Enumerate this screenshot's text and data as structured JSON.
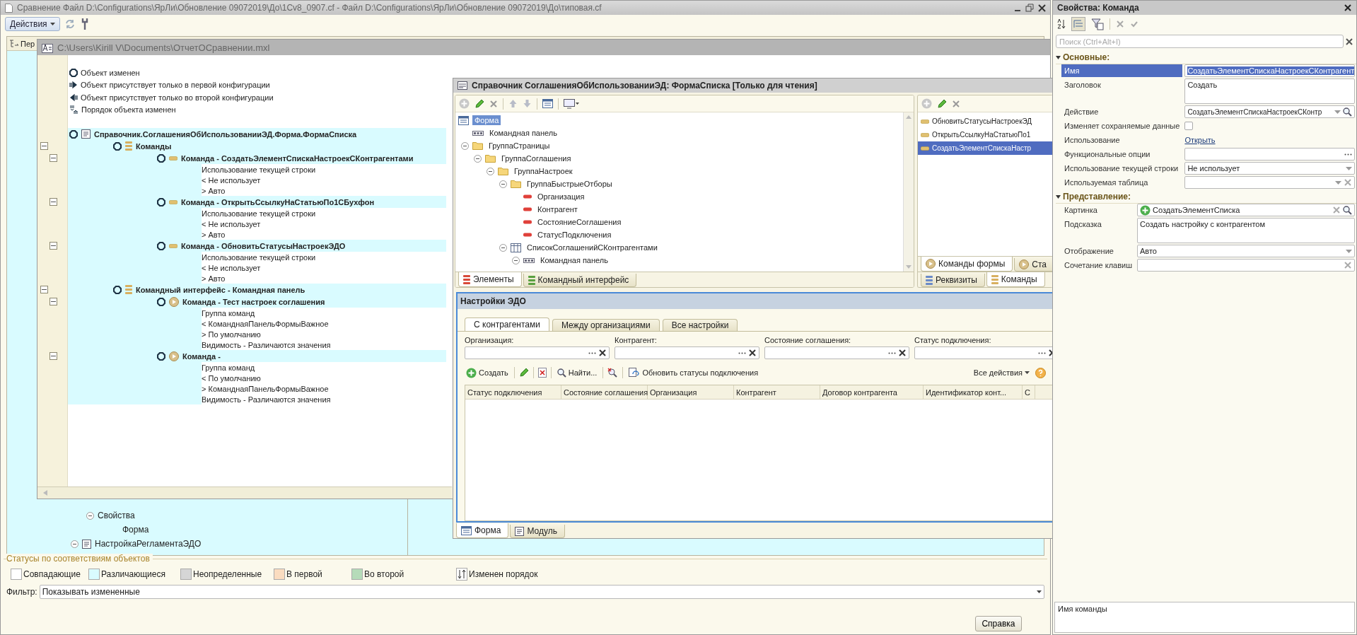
{
  "main_window": {
    "title": "Сравнение Файл D:\\Configurations\\ЯрЛи\\Обновление 09072019\\До\\1Cv8_0907.cf - Файл D:\\Configurations\\ЯрЛи\\Обновление 09072019\\До\\типовая.cf",
    "actions_button": "Действия",
    "column_header": "Пер",
    "tree_items": [
      {
        "label": "Свойства",
        "kind": "group",
        "expanded": true,
        "children": [
          {
            "label": "Форма",
            "kind": "leaf"
          }
        ]
      },
      {
        "label": "НастройкаРегламентаЭДО",
        "kind": "form",
        "expanded": true
      }
    ],
    "legend": {
      "title": "Статусы по соответствиям объектов",
      "items": [
        {
          "label": "Совпадающие",
          "kind": "swatch",
          "color": "#ffffff"
        },
        {
          "label": "Различающиеся",
          "kind": "swatch",
          "color": "#d9fbff"
        },
        {
          "label": "Неопределенные",
          "kind": "swatch",
          "color": "#d6d6d6"
        },
        {
          "label": "В первой",
          "kind": "swatch",
          "color": "#fadcc0"
        },
        {
          "label": "Во второй",
          "kind": "swatch",
          "color": "#b5dbb9"
        },
        {
          "label": "Изменен порядок",
          "kind": "order"
        }
      ]
    },
    "filter": {
      "label": "Фильтр:",
      "value": "Показывать измененные"
    },
    "help_button": "Справка"
  },
  "report_window": {
    "title": "C:\\Users\\Kirill V\\Documents\\ОтчетОСравнении.mxl",
    "legend_lines": [
      {
        "kind": "changed",
        "text": "Объект изменен"
      },
      {
        "kind": "first",
        "text": "Объект присутствует только в первой конфигурации"
      },
      {
        "kind": "second",
        "text": "Объект присутствует только во второй конфигурации"
      },
      {
        "kind": "order",
        "text": "Порядок объекта изменен"
      }
    ],
    "tree": {
      "label": "Справочник.СоглашенияОбИспользованииЭД.Форма.ФормаСписка",
      "kind": "form",
      "children": [
        {
          "label": "Команды",
          "kind": "group",
          "expanded": true,
          "children": [
            {
              "label": "Команда - СоздатьЭлементСпискаНастроекСКонтрагентами",
              "kind": "command",
              "expanded": true,
              "details": [
                "Использование текущей строки",
                "< Не использует",
                "> Авто"
              ]
            },
            {
              "label": "Команда - ОткрытьСсылкуНаСтатьюПо1СБухфон",
              "kind": "command",
              "expanded": true,
              "details": [
                "Использование текущей строки",
                "< Не использует",
                "> Авто"
              ]
            },
            {
              "label": "Команда - ОбновитьСтатусыНастроекЭДО",
              "kind": "command",
              "expanded": true,
              "details": [
                "Использование текущей строки",
                "< Не использует",
                "> Авто"
              ]
            }
          ]
        },
        {
          "label": "Командный интерфейс - Командная панель",
          "kind": "group",
          "expanded": true,
          "children": [
            {
              "label": "Команда - Тест настроек соглашения",
              "kind": "interface_command",
              "expanded": true,
              "details": [
                "Группа команд",
                "< КоманднаяПанельФормыВажное",
                "> По умолчанию",
                "Видимость - Различаются значения"
              ]
            },
            {
              "label": "Команда -",
              "kind": "interface_command",
              "expanded": true,
              "details": [
                "Группа команд",
                "< По умолчанию",
                "> КоманднаяПанельФормыВажное",
                "Видимость - Различаются значения"
              ]
            }
          ]
        }
      ]
    }
  },
  "form_window": {
    "title": "Справочник СоглашенияОбИспользованииЭД: ФормаСписка [Только для чтения]",
    "elements": {
      "label": "Форма",
      "kind": "form",
      "selected": true,
      "children": [
        {
          "label": "Командная панель",
          "kind": "cmdbar",
          "selected": false
        },
        {
          "label": "ГруппаСтраницы",
          "kind": "folder",
          "expanded": true,
          "selected": false,
          "children": [
            {
              "label": "ГруппаСоглашения",
              "kind": "folder",
              "expanded": true,
              "selected": false,
              "children": [
                {
                  "label": "ГруппаНастроек",
                  "kind": "folder",
                  "expanded": true,
                  "selected": false,
                  "children": [
                    {
                      "label": "ГруппаБыстрыеОтборы",
                      "kind": "folder",
                      "expanded": true,
                      "selected": false,
                      "children": [
                        {
                          "label": "Организация",
                          "kind": "field",
                          "selected": false
                        },
                        {
                          "label": "Контрагент",
                          "kind": "field",
                          "selected": false
                        },
                        {
                          "label": "СостояниеСоглашения",
                          "kind": "field",
                          "selected": false
                        },
                        {
                          "label": "СтатусПодключения",
                          "kind": "field",
                          "selected": false
                        }
                      ]
                    },
                    {
                      "label": "СписокСоглашенийСКонтрагентами",
                      "kind": "table",
                      "expanded": true,
                      "selected": false,
                      "children": [
                        {
                          "label": "Командная панель",
                          "kind": "cmdbar",
                          "expanded": true,
                          "selected": false
                        }
                      ]
                    }
                  ]
                }
              ]
            }
          ]
        }
      ]
    },
    "element_tabs": [
      {
        "label": "Элементы",
        "selected": true
      },
      {
        "label": "Командный интерфейс",
        "selected": false
      }
    ],
    "commands": [
      {
        "label": "ОбновитьСтатусыНастроекЭД",
        "selected": false
      },
      {
        "label": "ОткрытьСсылкуНаСтатьюПо1",
        "selected": false
      },
      {
        "label": "СоздатьЭлементСпискаНастр",
        "selected": true
      }
    ],
    "command_tabs": [
      {
        "label": "Команды формы",
        "selected": true
      },
      {
        "label": "Ста",
        "selected": false
      }
    ],
    "data_tabs": [
      {
        "label": "Реквизиты",
        "selected": false
      },
      {
        "label": "Команды",
        "selected": true
      }
    ],
    "preview": {
      "title": "Настройки ЭДО",
      "tabs": [
        {
          "label": "С контрагентами",
          "selected": true
        },
        {
          "label": "Между организациями",
          "selected": false
        },
        {
          "label": "Все настройки",
          "selected": false
        }
      ],
      "filters": [
        "Организация:",
        "Контрагент:",
        "Состояние соглашения:",
        "Статус подключения:"
      ],
      "create_button": "Создать",
      "find_button": "Найти...",
      "refresh_button": "Обновить статусы подключения",
      "all_actions": "Все действия",
      "columns": [
        "Статус подключения",
        "Состояние соглашения",
        "Организация",
        "Контрагент",
        "Договор контрагента",
        "Идентификатор конт...",
        "С"
      ]
    },
    "bottom_tabs": [
      {
        "label": "Форма",
        "selected": true
      },
      {
        "label": "Модуль",
        "selected": false
      }
    ]
  },
  "properties": {
    "title": "Свойства: Команда",
    "search": {
      "placeholder": "Поиск (Ctrl+Alt+I)"
    },
    "sections": [
      {
        "title": "Основные:",
        "expanded": true,
        "rows": [
          {
            "label": "Имя",
            "kind": "text",
            "value": "СоздатьЭлементСпискаНастроекСКонтрагент",
            "selected": true
          },
          {
            "label": "Заголовок",
            "kind": "textarea",
            "value": "Создать",
            "selected": false
          },
          {
            "label": "Действие",
            "kind": "select_search",
            "value": "СоздатьЭлементСпискаНастроекСКонтр",
            "selected": false
          },
          {
            "label": "Изменяет сохраняемые данные",
            "kind": "checkbox",
            "checked": false,
            "selected": false
          },
          {
            "label": "Использование",
            "kind": "link",
            "value": "Открыть",
            "selected": false
          },
          {
            "label": "Функциональные опции",
            "kind": "choice",
            "selected": false
          },
          {
            "label": "Использование текущей строки",
            "kind": "select",
            "value": "Не использует",
            "selected": false
          },
          {
            "label": "Используемая таблица",
            "kind": "select_clear",
            "selected": false
          }
        ]
      },
      {
        "title": "Представление:",
        "expanded": true,
        "rows": [
          {
            "label": "Картинка",
            "kind": "picture",
            "value": "СоздатьЭлементСписка",
            "selected": false
          },
          {
            "label": "Подсказка",
            "kind": "textarea",
            "value": "Создать настройку с контрагентом",
            "selected": false
          },
          {
            "label": "Отображение",
            "kind": "select",
            "value": "Авто",
            "selected": false
          },
          {
            "label": "Сочетание клавиш",
            "kind": "clear",
            "selected": false
          }
        ]
      }
    ],
    "footer": "Имя команды"
  }
}
